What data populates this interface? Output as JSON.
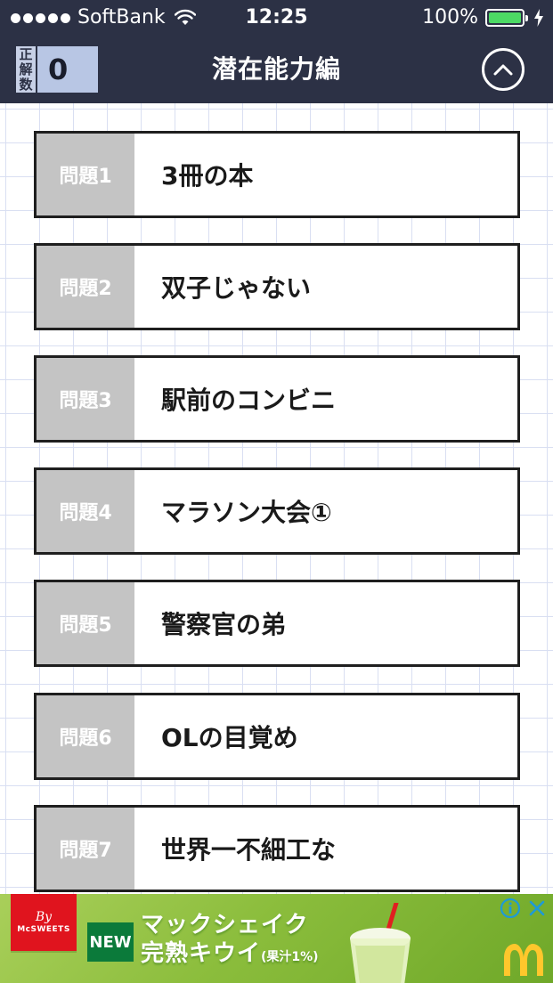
{
  "status_bar": {
    "carrier": "SoftBank",
    "time": "12:25",
    "battery": "100%",
    "battery_level": 1.0,
    "battery_color": "#4cd964"
  },
  "nav": {
    "score_label": "正解数",
    "score_value": "0",
    "title": "潜在能力編",
    "up_icon": "chevron-up-icon"
  },
  "questions": [
    {
      "num": "問題1",
      "title": "3冊の本"
    },
    {
      "num": "問題2",
      "title": "双子じゃない"
    },
    {
      "num": "問題3",
      "title": "駅前のコンビニ"
    },
    {
      "num": "問題4",
      "title": "マラソン大会①"
    },
    {
      "num": "問題5",
      "title": "警察官の弟"
    },
    {
      "num": "問題6",
      "title": "OLの目覚め"
    },
    {
      "num": "問題7",
      "title": "世界一不細工な"
    }
  ],
  "ad": {
    "logo_by": "By",
    "logo_brand": "McSWEETS",
    "badge": "NEW",
    "headline": "マックシェイク",
    "subline": "完熟キウイ",
    "note": "(果汁1%)",
    "info_icon": "info-icon",
    "close_icon": "close-icon"
  },
  "colors": {
    "header_bg": "#2c3145",
    "score_bg": "#b8c6e4",
    "question_num_bg": "#c4c4c4",
    "grid_line": "#d9dff2",
    "ad_bg": "#8bbd3c"
  }
}
